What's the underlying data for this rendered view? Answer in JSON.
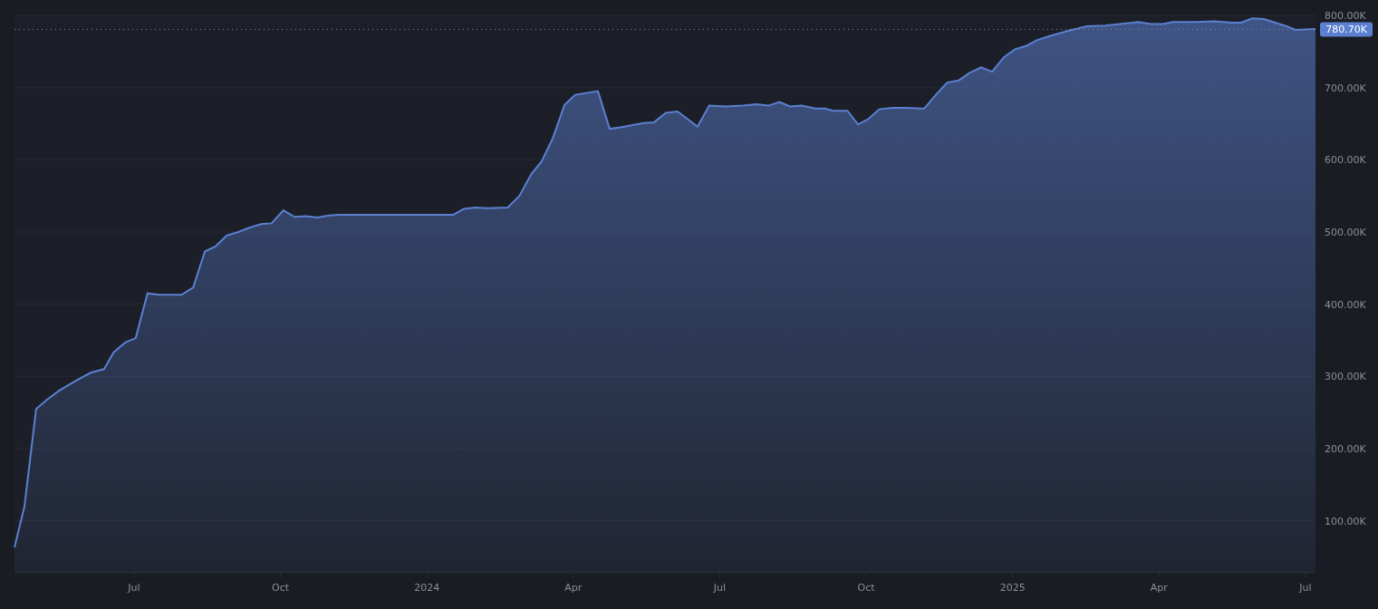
{
  "chart_data": {
    "type": "area",
    "xlim": [
      2023.296,
      2025.517
    ],
    "ylim": [
      28,
      800
    ],
    "grid": true,
    "xticks": [
      {
        "value": 2023.5,
        "label": "Jul"
      },
      {
        "value": 2023.75,
        "label": "Oct"
      },
      {
        "value": 2024,
        "label": "2024"
      },
      {
        "value": 2024.25,
        "label": "Apr"
      },
      {
        "value": 2024.5,
        "label": "Jul"
      },
      {
        "value": 2024.75,
        "label": "Oct"
      },
      {
        "value": 2025,
        "label": "2025"
      },
      {
        "value": 2025.25,
        "label": "Apr"
      },
      {
        "value": 2025.5,
        "label": "Jul"
      }
    ],
    "yticks": [
      {
        "value": 100,
        "label": "100.00K"
      },
      {
        "value": 200,
        "label": "200.00K"
      },
      {
        "value": 300,
        "label": "300.00K"
      },
      {
        "value": 400,
        "label": "400.00K"
      },
      {
        "value": 500,
        "label": "500.00K"
      },
      {
        "value": 600,
        "label": "600.00K"
      },
      {
        "value": 700,
        "label": "700.00K"
      },
      {
        "value": 800,
        "label": "800.00K"
      }
    ],
    "x": [
      2023.296,
      2023.313,
      2023.333,
      2023.352,
      2023.372,
      2023.392,
      2023.41,
      2023.426,
      2023.449,
      2023.465,
      2023.485,
      2023.503,
      2023.523,
      2023.542,
      2023.581,
      2023.601,
      2023.621,
      2023.639,
      2023.658,
      2023.678,
      2023.697,
      2023.717,
      2023.735,
      2023.755,
      2023.774,
      2023.794,
      2023.813,
      2023.833,
      2023.851,
      2023.89,
      2023.967,
      2024.045,
      2024.063,
      2024.083,
      2024.103,
      2024.138,
      2024.158,
      2024.178,
      2024.196,
      2024.215,
      2024.235,
      2024.253,
      2024.292,
      2024.312,
      2024.331,
      2024.37,
      2024.388,
      2024.408,
      2024.428,
      2024.462,
      2024.482,
      2024.509,
      2024.54,
      2024.563,
      2024.583,
      2024.602,
      2024.62,
      2024.64,
      2024.663,
      2024.679,
      2024.694,
      2024.718,
      2024.736,
      2024.753,
      2024.772,
      2024.795,
      2024.818,
      2024.849,
      2024.869,
      2024.888,
      2024.908,
      2024.926,
      2024.946,
      2024.965,
      2024.985,
      2025.004,
      2025.024,
      2025.042,
      2025.066,
      2025.096,
      2025.127,
      2025.158,
      2025.205,
      2025.214,
      2025.236,
      2025.256,
      2025.274,
      2025.313,
      2025.344,
      2025.375,
      2025.39,
      2025.409,
      2025.429,
      2025.452,
      2025.468,
      2025.483,
      2025.517
    ],
    "series": [
      {
        "color": "#5b80d2",
        "values": [
          63,
          120,
          255,
          268,
          280,
          290,
          298,
          305,
          310,
          333,
          347,
          353,
          415,
          413,
          413,
          423,
          473,
          480,
          495,
          500,
          506,
          511,
          512,
          530,
          521,
          522,
          520,
          523,
          524,
          524,
          524,
          524,
          532,
          534,
          533,
          534,
          550,
          580,
          598,
          630,
          676,
          690,
          695,
          643,
          645,
          651,
          652,
          665,
          667,
          646,
          675,
          674,
          675,
          677,
          675,
          680,
          674,
          675,
          671,
          671,
          668,
          668,
          649,
          656,
          670,
          672,
          672,
          671,
          690,
          707,
          710,
          720,
          728,
          722,
          742,
          753,
          758,
          766,
          772,
          779,
          785,
          786,
          790,
          791,
          788,
          788,
          791,
          791,
          792,
          790,
          790,
          796,
          795,
          789,
          785,
          780,
          781
        ]
      }
    ],
    "ref_lines": [
      {
        "axis": "y",
        "value": 780.7
      }
    ],
    "annotations": [
      "780.70K"
    ]
  }
}
